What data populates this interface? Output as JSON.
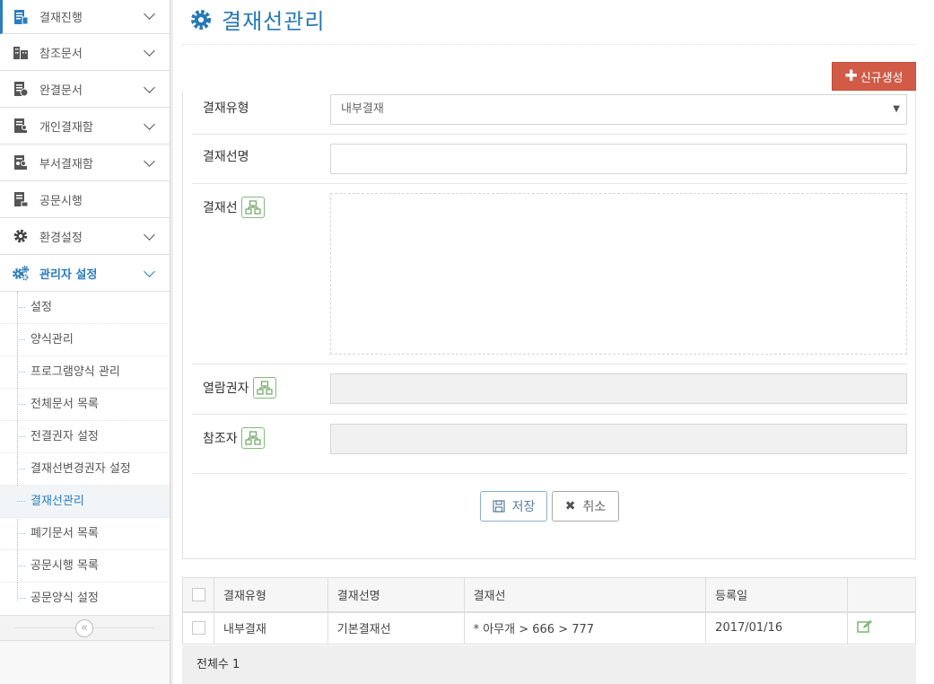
{
  "sidebar": {
    "menu": [
      {
        "label": "결재진행",
        "icon": "document-progress-icon"
      },
      {
        "label": "참조문서",
        "icon": "building-icon"
      },
      {
        "label": "완결문서",
        "icon": "document-check-icon"
      },
      {
        "label": "개인결재함",
        "icon": "user-document-icon"
      },
      {
        "label": "부서결재함",
        "icon": "team-document-icon"
      },
      {
        "label": "공문시행",
        "icon": "document-send-icon"
      },
      {
        "label": "환경설정",
        "icon": "gear-icon"
      },
      {
        "label": "관리자 설정",
        "icon": "gears-icon"
      }
    ],
    "submenu": [
      "설정",
      "양식관리",
      "프로그램양식 관리",
      "전체문서 목록",
      "전결권자 설정",
      "결재선변경권자 설정",
      "결재선관리",
      "폐기문서 목록",
      "공문시행 목록",
      "공문양식 설정"
    ],
    "collapse_label": "«"
  },
  "header": {
    "title": "결재선관리",
    "new_button": "신규생성",
    "new_icon": "plus-icon"
  },
  "form": {
    "type_label": "결재유형",
    "type_value": "내부결재",
    "name_label": "결재선명",
    "line_label": "결재선",
    "viewer_label": "열람권자",
    "ref_label": "참조자",
    "save_label": "저장",
    "cancel_label": "취소"
  },
  "table": {
    "headers": [
      "결재유형",
      "결재선명",
      "결재선",
      "등록일"
    ],
    "rows": [
      {
        "type": "내부결재",
        "name": "기본결재선",
        "line": "* 아무개 > 666 > 777",
        "date": "2017/01/16"
      }
    ],
    "total": "전체수 1"
  },
  "colors": {
    "accent": "#2679b5",
    "danger": "#d15b47",
    "org": "#87b87f"
  }
}
